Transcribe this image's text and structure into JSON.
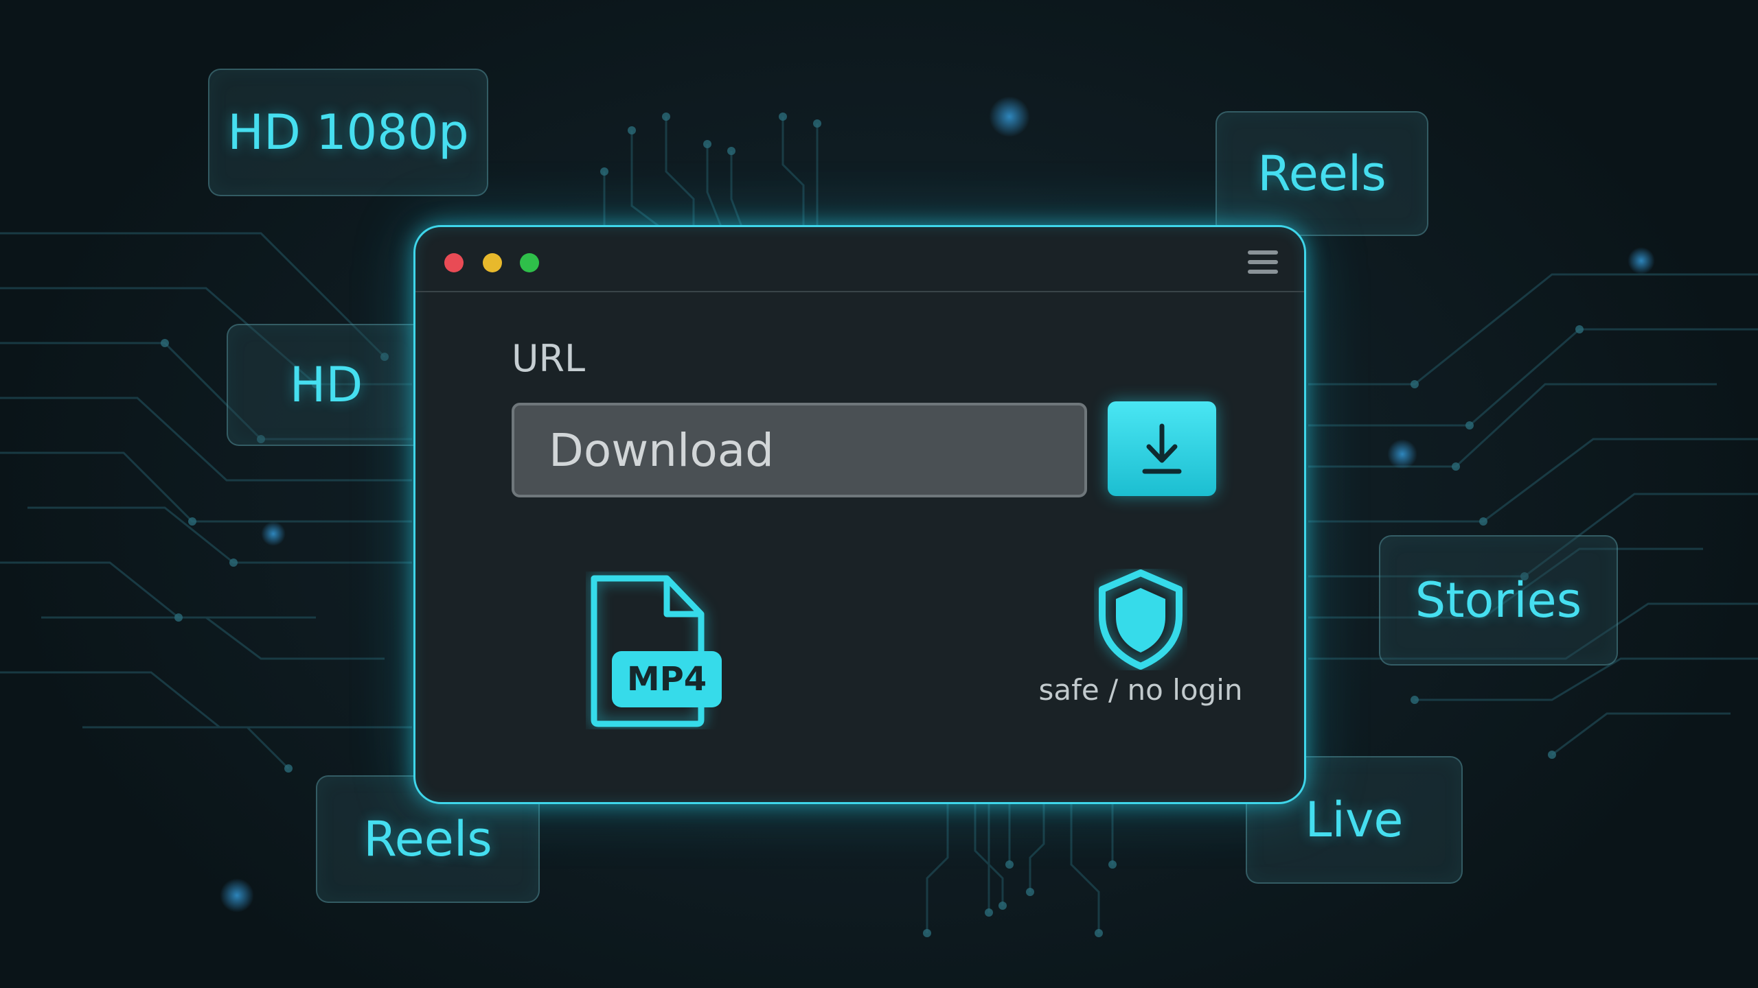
{
  "colors": {
    "accent": "#3fd6ea",
    "window_bg": "#1a2226",
    "close": "#e94b55",
    "minimize": "#e8b92c",
    "maximize": "#2fbf4a"
  },
  "tags": {
    "hd_1080p": "HD 1080p",
    "reels_top": "Reels",
    "hd": "HD",
    "stories": "Stories",
    "reels_bottom": "Reels",
    "live": "Live"
  },
  "window": {
    "menu_icon": "hamburger-menu-icon",
    "url_label": "URL",
    "url_input_value": "Download",
    "download_icon": "download-arrow-icon",
    "file_format_badge": "MP4",
    "file_icon": "file-icon",
    "shield_icon": "shield-icon",
    "safe_label": "safe / no login"
  }
}
